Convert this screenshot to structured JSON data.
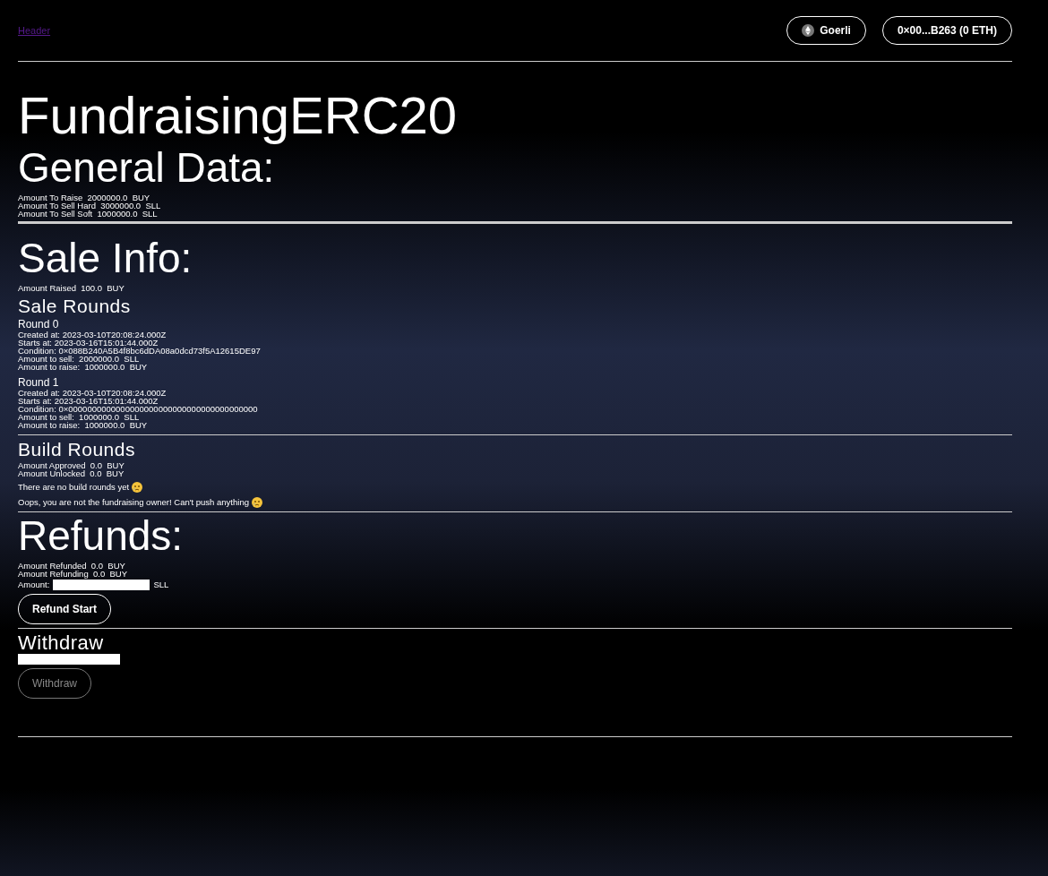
{
  "header": {
    "link": "Header",
    "network_button": "Goerli",
    "account_button": "0×00...B263 (0 ETH)"
  },
  "title": "FundraisingERC20",
  "general_data": {
    "heading": "General Data:",
    "rows": [
      {
        "label": "Amount To Raise",
        "value": "2000000.0",
        "unit": "BUY"
      },
      {
        "label": "Amount To Sell Hard",
        "value": "3000000.0",
        "unit": "SLL"
      },
      {
        "label": "Amount To Sell Soft",
        "value": "1000000.0",
        "unit": "SLL"
      }
    ]
  },
  "sale_info": {
    "heading": "Sale Info:",
    "rows": [
      {
        "label": "Amount Raised",
        "value": "100.0",
        "unit": "BUY"
      }
    ],
    "sale_rounds": {
      "heading": "Sale Rounds",
      "rounds": [
        {
          "title": "Round 0",
          "created": "Created at: 2023-03-10T20:08:24.000Z",
          "starts": "Starts at: 2023-03-16T15:01:44.000Z",
          "condition": "Condition: 0×088B240A5B4f8bc6dDA08a0dcd73f5A12615DE97",
          "sell": "Amount to sell:  2000000.0  SLL",
          "raise": "Amount to raise:  1000000.0  BUY"
        },
        {
          "title": "Round 1",
          "created": "Created at: 2023-03-10T20:08:24.000Z",
          "starts": "Starts at: 2023-03-16T15:01:44.000Z",
          "condition": "Condition: 0×0000000000000000000000000000000000000000",
          "sell": "Amount to sell:  1000000.0  SLL",
          "raise": "Amount to raise:  1000000.0  BUY"
        }
      ]
    },
    "build_rounds": {
      "heading": "Build Rounds",
      "rows": [
        {
          "label": "Amount Approved",
          "value": "0.0",
          "unit": "BUY"
        },
        {
          "label": "Amount Unlocked",
          "value": "0.0",
          "unit": "BUY"
        }
      ],
      "messages": [
        "There are no build rounds yet",
        "Oops, you are not the fundraising owner! Can't push anything"
      ]
    }
  },
  "refunds": {
    "heading": "Refunds:",
    "rows": [
      {
        "label": "Amount Refunded",
        "value": "0.0",
        "unit": "BUY"
      },
      {
        "label": "Amount Refunding",
        "value": "0.0",
        "unit": "BUY"
      }
    ],
    "amount_label": "Amount:",
    "amount_unit": "SLL",
    "button": {
      "label": "Refund Start",
      "disabled": false
    }
  },
  "withdraw": {
    "heading": "Withdraw",
    "button": {
      "label": "Withdraw",
      "disabled": true
    }
  }
}
